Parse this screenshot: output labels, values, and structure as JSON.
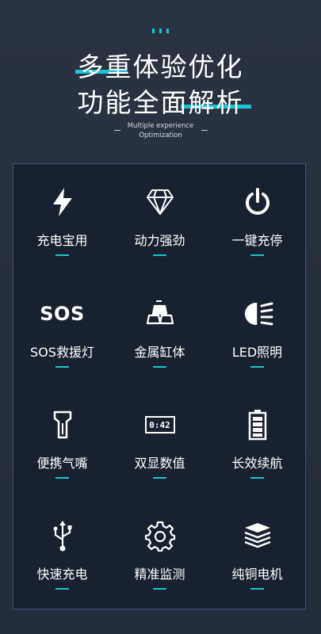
{
  "header": {
    "title_line1": "多重体验优化",
    "title_line2": "功能全面解析",
    "subtitle_line1": "Multiple experience",
    "subtitle_line2": "Optimization",
    "accent_color": "#1ec2d6"
  },
  "features": [
    {
      "label": "充电宝用",
      "icon": "lightning-icon"
    },
    {
      "label": "动力强劲",
      "icon": "diamond-icon"
    },
    {
      "label": "一键充停",
      "icon": "power-icon"
    },
    {
      "label": "SOS救援灯",
      "icon": "sos-icon",
      "icon_text": "SOS"
    },
    {
      "label": "金属缸体",
      "icon": "metal-bars-icon"
    },
    {
      "label": "LED照明",
      "icon": "headlight-icon"
    },
    {
      "label": "便携气嘴",
      "icon": "air-nozzle-icon"
    },
    {
      "label": "双显数值",
      "icon": "digital-display-icon",
      "icon_text": "0:42"
    },
    {
      "label": "长效续航",
      "icon": "battery-icon"
    },
    {
      "label": "快速充电",
      "icon": "usb-icon"
    },
    {
      "label": "精准监测",
      "icon": "gear-icon"
    },
    {
      "label": "纯铜电机",
      "icon": "copper-coil-icon"
    }
  ]
}
